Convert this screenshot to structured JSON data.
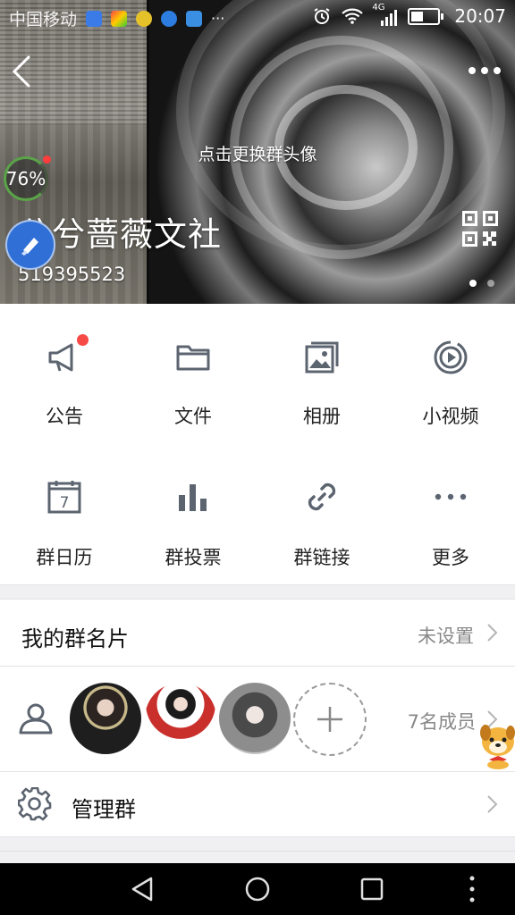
{
  "status_bar": {
    "carrier": "中国移动",
    "time": "20:07",
    "network": "4G",
    "more": "···"
  },
  "header": {
    "change_avatar_hint": "点击更换群头像",
    "group_name": "兮兮蔷薇文社",
    "group_id": "519395523",
    "overlay_percent": "76%"
  },
  "features": [
    {
      "label": "公告",
      "icon": "megaphone-icon",
      "has_badge": true
    },
    {
      "label": "文件",
      "icon": "folder-icon"
    },
    {
      "label": "相册",
      "icon": "album-icon"
    },
    {
      "label": "小视频",
      "icon": "video-icon"
    },
    {
      "label": "群日历",
      "icon": "calendar-icon",
      "calendar_day": "7"
    },
    {
      "label": "群投票",
      "icon": "vote-chart-icon"
    },
    {
      "label": "群链接",
      "icon": "link-icon"
    },
    {
      "label": "更多",
      "icon": "more-icon"
    }
  ],
  "group_card": {
    "title": "我的群名片",
    "value": "未设置"
  },
  "members": {
    "count_label": "7名成员"
  },
  "manage": {
    "title": "管理群"
  },
  "colors": {
    "icon_gray": "#5c6470",
    "badge_red": "#f54a45",
    "hint_gray": "#888888"
  }
}
